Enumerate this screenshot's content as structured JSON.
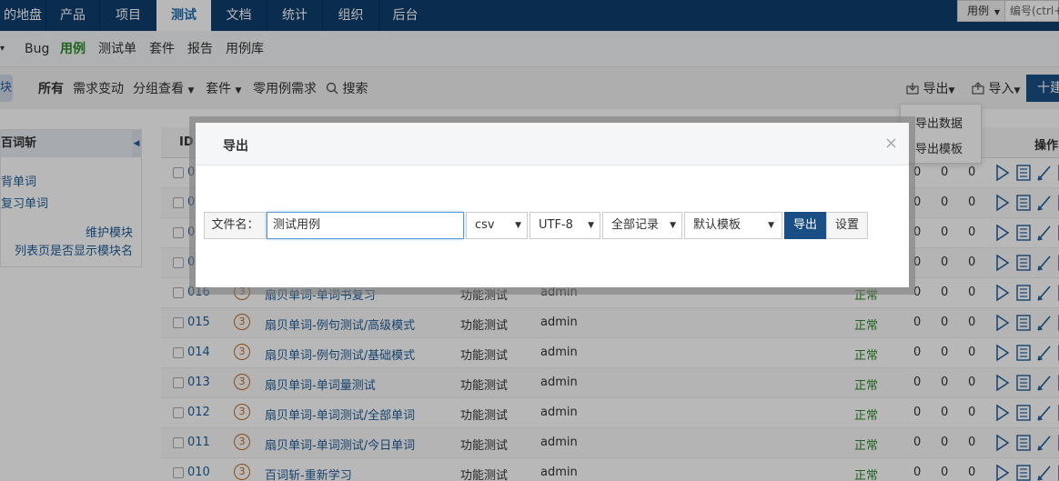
{
  "top_nav": {
    "items": [
      "的地盘",
      "产品",
      "项目",
      "测试",
      "文档",
      "统计",
      "组织",
      "后台"
    ],
    "active": "测试",
    "search_type": "用例",
    "search_placeholder": "编号(ctrl+g"
  },
  "sub_nav": {
    "items": [
      "Bug",
      "用例",
      "测试单",
      "套件",
      "报告",
      "用例库"
    ],
    "active": "用例"
  },
  "toolbar": {
    "module_tab": "块",
    "items": [
      "所有",
      "需求变动",
      "分组查看",
      "套件",
      "零用例需求",
      "搜索"
    ],
    "export_label": "导出",
    "import_label": "导入",
    "create_label": "十建"
  },
  "export_menu": {
    "items": [
      "导出数据",
      "导出模板"
    ]
  },
  "sidebar": {
    "title": "百词斩",
    "links": [
      "背单词",
      "复习单词"
    ],
    "maintain": "维护模块",
    "show_module": "列表页是否显示模块名"
  },
  "table": {
    "headers": {
      "id": "ID",
      "actions": "操作"
    },
    "rows": [
      {
        "id": "02",
        "title": "",
        "type": "",
        "owner": "",
        "status": "",
        "n1": "0",
        "n2": "0",
        "n3": "0"
      },
      {
        "id": "01",
        "title": "",
        "type": "",
        "owner": "",
        "status": "",
        "n1": "0",
        "n2": "0",
        "n3": "0"
      },
      {
        "id": "01",
        "title": "",
        "type": "",
        "owner": "",
        "status": "",
        "n1": "0",
        "n2": "0",
        "n3": "0"
      },
      {
        "id": "01",
        "title": "",
        "type": "",
        "owner": "",
        "status": "",
        "n1": "0",
        "n2": "0",
        "n3": "0"
      },
      {
        "id": "016",
        "pri": "3",
        "title": "扇贝单词-单词书复习",
        "type": "功能测试",
        "owner": "admin",
        "status": "正常",
        "n1": "0",
        "n2": "0",
        "n3": "0"
      },
      {
        "id": "015",
        "pri": "3",
        "title": "扇贝单词-例句测试/高级模式",
        "type": "功能测试",
        "owner": "admin",
        "status": "正常",
        "n1": "0",
        "n2": "0",
        "n3": "0"
      },
      {
        "id": "014",
        "pri": "3",
        "title": "扇贝单词-例句测试/基础模式",
        "type": "功能测试",
        "owner": "admin",
        "status": "正常",
        "n1": "0",
        "n2": "0",
        "n3": "0"
      },
      {
        "id": "013",
        "pri": "3",
        "title": "扇贝单词-单词量测试",
        "type": "功能测试",
        "owner": "admin",
        "status": "正常",
        "n1": "0",
        "n2": "0",
        "n3": "0"
      },
      {
        "id": "012",
        "pri": "3",
        "title": "扇贝单词-单词测试/全部单词",
        "type": "功能测试",
        "owner": "admin",
        "status": "正常",
        "n1": "0",
        "n2": "0",
        "n3": "0"
      },
      {
        "id": "011",
        "pri": "3",
        "title": "扇贝单词-单词测试/今日单词",
        "type": "功能测试",
        "owner": "admin",
        "status": "正常",
        "n1": "0",
        "n2": "0",
        "n3": "0"
      },
      {
        "id": "010",
        "pri": "3",
        "title": "百词斩-重新学习",
        "type": "功能测试",
        "owner": "admin",
        "status": "正常",
        "n1": "0",
        "n2": "0",
        "n3": "0"
      }
    ]
  },
  "modal": {
    "title": "导出",
    "close": "×",
    "filename_label": "文件名：",
    "filename_value": "测试用例",
    "format": "csv",
    "encoding": "UTF-8",
    "range": "全部记录",
    "template": "默认模板",
    "export_button": "导出",
    "settings_button": "设置"
  },
  "colors": {
    "nav_bg": "#0f3d6e",
    "primary": "#1a4f86",
    "link": "#1f5d99",
    "success": "#2d8a2d"
  }
}
